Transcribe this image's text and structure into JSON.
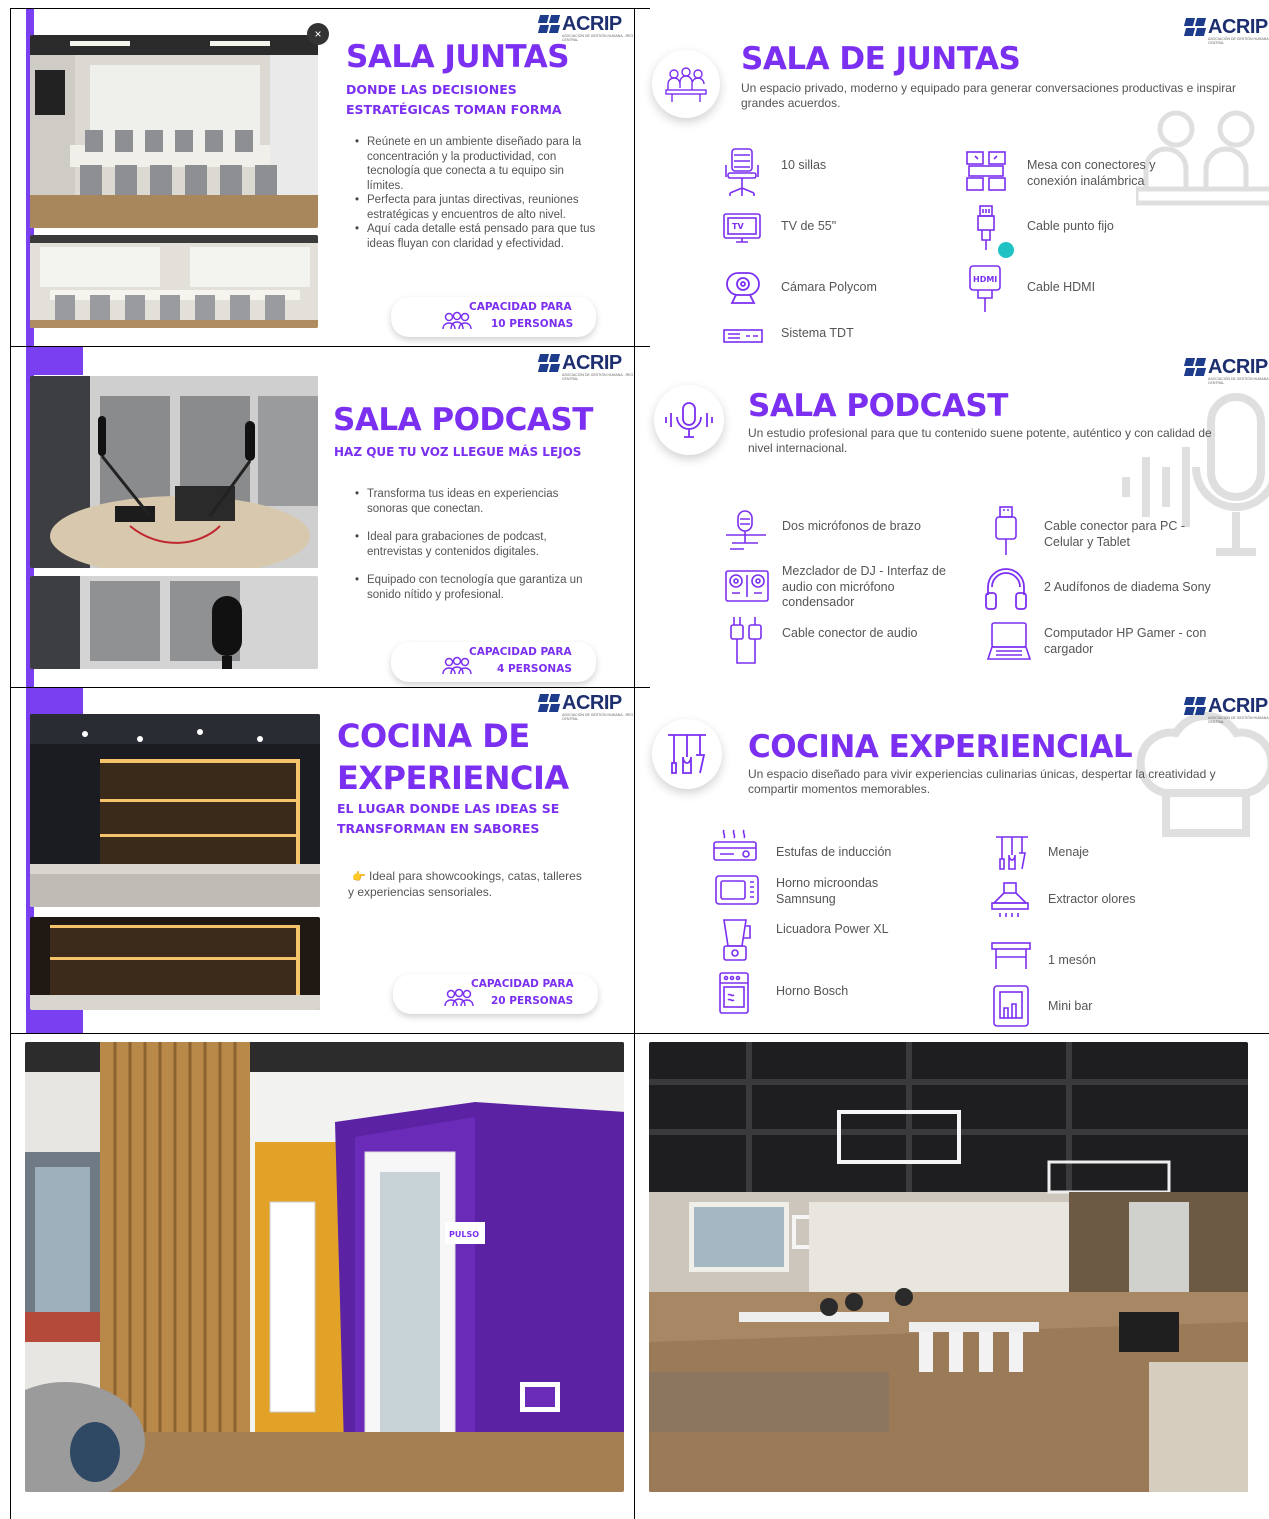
{
  "brand": {
    "logo_text": "ACRIP",
    "logo_sub": "ASOCIACIÓN DE GESTIÓN HUMANA - REGIÓN CENTRAL"
  },
  "colors": {
    "accent": "#7b2ff0",
    "bar": "#7b3ff2",
    "logo": "#1d2f6f"
  },
  "juntas_left": {
    "title": "SALA JUNTAS",
    "subtitle_line1": "DONDE LAS DECISIONES",
    "subtitle_line2": "ESTRATÉGICAS TOMAN FORMA",
    "bullets": [
      "Reúnete en un ambiente diseñado para la concentración y la productividad, con tecnología que conecta a tu equipo sin límites.",
      "Perfecta para juntas directivas, reuniones estratégicas y encuentros de alto nivel.",
      "Aquí cada detalle está pensado para que tus ideas fluyan con claridad y efectividad."
    ],
    "capacity_label": "CAPACIDAD PARA",
    "capacity_value": "10 PERSONAS",
    "close_glyph": "×"
  },
  "juntas_right": {
    "title": "SALA DE JUNTAS",
    "description": "Un espacio privado, moderno y equipado para generar conversaciones productivas e inspirar grandes acuerdos.",
    "features": [
      {
        "icon": "chair-icon",
        "label": "10 sillas"
      },
      {
        "icon": "conference-table-icon",
        "label": "Mesa con conectores y conexión inalámbrica"
      },
      {
        "icon": "tv-icon",
        "label": "TV de 55\""
      },
      {
        "icon": "ethernet-cable-icon",
        "label": "Cable punto fijo"
      },
      {
        "icon": "webcam-icon",
        "label": "Cámara Polycom"
      },
      {
        "icon": "hdmi-icon",
        "label": "Cable HDMI"
      },
      {
        "icon": "tdt-box-icon",
        "label": "Sistema TDT"
      }
    ]
  },
  "podcast_left": {
    "title": "SALA PODCAST",
    "subtitle": "HAZ QUE TU VOZ LLEGUE MÁS LEJOS",
    "bullets": [
      "Transforma tus ideas en experiencias sonoras que conectan.",
      "Ideal para grabaciones de podcast, entrevistas y contenidos digitales.",
      "Equipado con tecnología que garantiza un sonido nítido y profesional."
    ],
    "capacity_label": "CAPACIDAD PARA",
    "capacity_value": "4 PERSONAS"
  },
  "podcast_right": {
    "title": "SALA PODCAST",
    "description": "Un estudio profesional para que tu contenido suene potente, auténtico y con calidad de nivel internacional.",
    "features": [
      {
        "icon": "boom-mic-icon",
        "label": "Dos micrófonos de brazo"
      },
      {
        "icon": "usb-cable-icon",
        "label": "Cable conector para PC - Celular y Tablet"
      },
      {
        "icon": "dj-mixer-icon",
        "label": "Mezclador de DJ - Interfaz de audio con micrófono condensador"
      },
      {
        "icon": "headphones-icon",
        "label": "2 Audífonos de diadema Sony"
      },
      {
        "icon": "audio-cable-icon",
        "label": "Cable conector de audio"
      },
      {
        "icon": "laptop-icon",
        "label": "Computador HP Gamer - con cargador"
      }
    ]
  },
  "cocina_left": {
    "title_line1": "COCINA DE",
    "title_line2": "EXPERIENCIA",
    "subtitle_line1": "EL LUGAR DONDE LAS IDEAS SE",
    "subtitle_line2": "TRANSFORMAN EN SABORES",
    "text_line1": "Ideal para showcookings, catas, talleres",
    "text_line2": "y experiencias sensoriales.",
    "pointer_glyph": "👉",
    "capacity_label": "CAPACIDAD PARA",
    "capacity_value": "20 PERSONAS"
  },
  "cocina_right": {
    "title": "COCINA EXPERIENCIAL",
    "description": "Un espacio diseñado para vivir experiencias culinarias únicas, despertar la creatividad y compartir momentos memorables.",
    "features": [
      {
        "icon": "induction-stove-icon",
        "label": "Estufas de inducción"
      },
      {
        "icon": "utensils-icon",
        "label": "Menaje"
      },
      {
        "icon": "microwave-icon",
        "label": "Horno microondas Samnsung"
      },
      {
        "icon": "extractor-hood-icon",
        "label": "Extractor olores"
      },
      {
        "icon": "blender-icon",
        "label": "Licuadora Power XL"
      },
      {
        "icon": "counter-icon",
        "label": "1 mesón"
      },
      {
        "icon": "oven-icon",
        "label": "Horno Bosch"
      },
      {
        "icon": "minibar-icon",
        "label": "Mini bar"
      }
    ]
  },
  "photos": {
    "booth_sign": "PULSO"
  }
}
